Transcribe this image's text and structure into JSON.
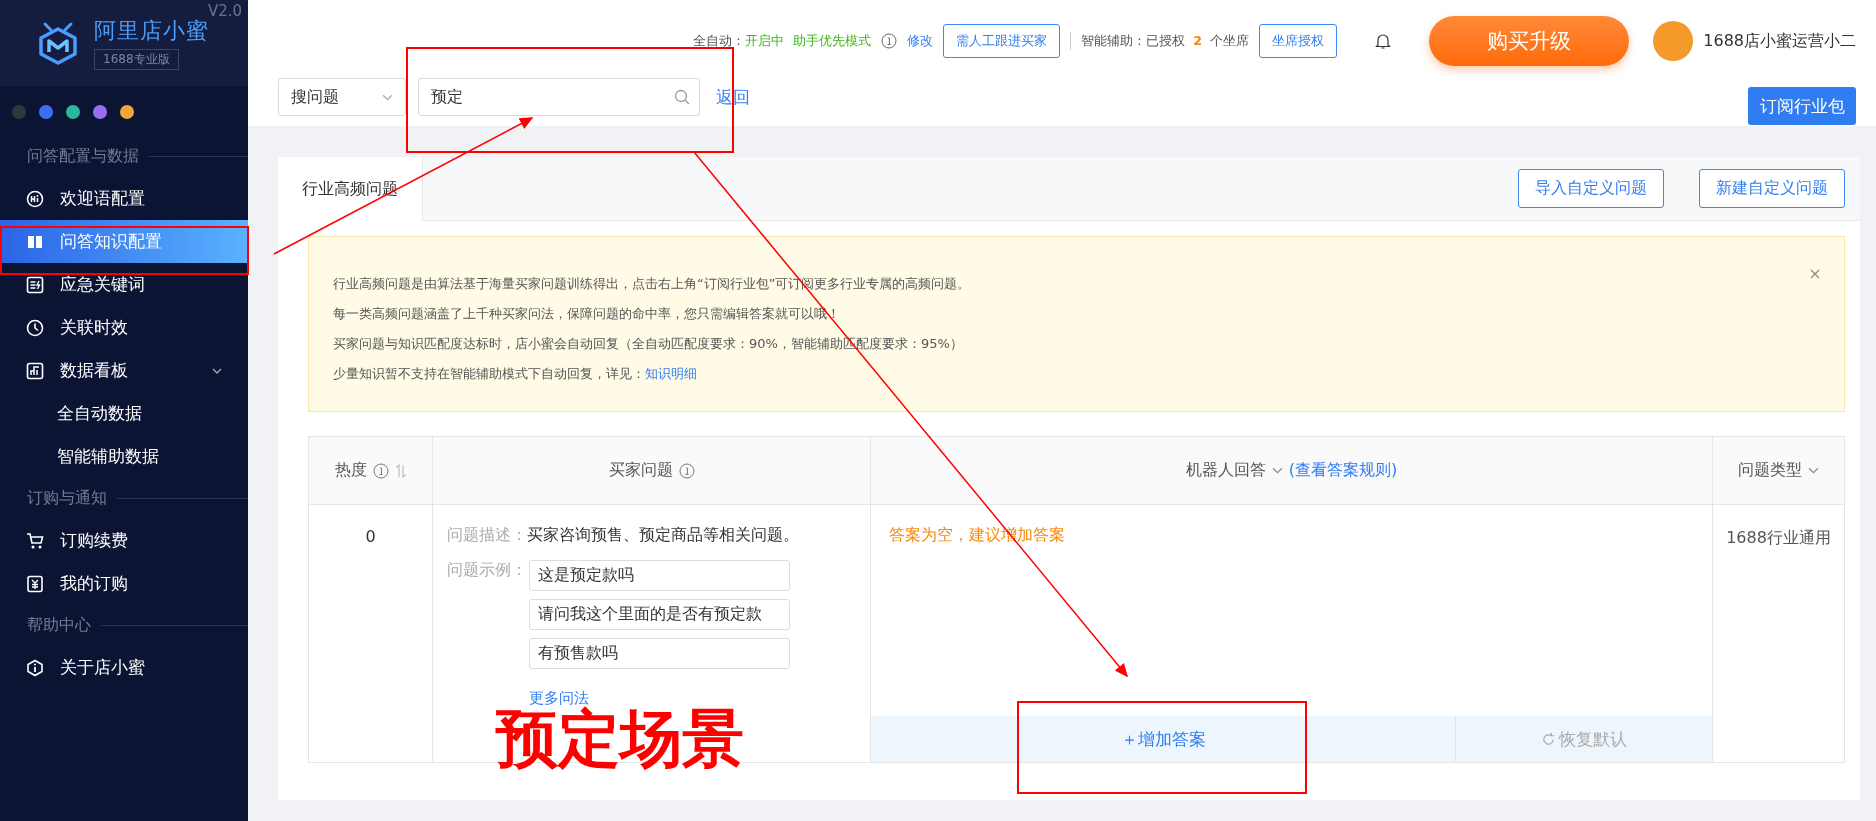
{
  "brand": {
    "name": "阿里店小蜜",
    "edition": "1688专业版",
    "version": "V2.0"
  },
  "theme_dots": [
    {
      "color": "#2b3a3a"
    },
    {
      "color": "#3d6ff5"
    },
    {
      "color": "#2bb89a"
    },
    {
      "color": "#9b6cf0"
    },
    {
      "color": "#f3a43a"
    }
  ],
  "sidebar": {
    "sections": [
      {
        "title": "问答配置与数据",
        "items": [
          {
            "kind": "hi",
            "label": "欢迎语配置",
            "selected": false
          },
          {
            "kind": "book",
            "label": "问答知识配置",
            "selected": true
          },
          {
            "kind": "keyword",
            "label": "应急关键词",
            "selected": false
          },
          {
            "kind": "clock",
            "label": "关联时效",
            "selected": false
          },
          {
            "kind": "chart",
            "label": "数据看板",
            "selected": false,
            "expanded": true,
            "children": [
              {
                "label": "全自动数据",
                "selected": false
              },
              {
                "label": "智能辅助数据",
                "selected": false
              }
            ]
          }
        ]
      },
      {
        "title": "订购与通知",
        "items": [
          {
            "kind": "cart",
            "label": "订购续费",
            "selected": false
          },
          {
            "kind": "order",
            "label": "我的订购",
            "selected": false
          }
        ]
      },
      {
        "title": "帮助中心",
        "items": [
          {
            "kind": "info",
            "label": "关于店小蜜",
            "selected": false
          }
        ]
      }
    ]
  },
  "header": {
    "auto_label": "全自动：",
    "auto_status": "开启中",
    "auto_mode": "助手优先模式",
    "edit_link": "修改",
    "manual_button": "需人工跟进买家",
    "assist_label": "智能辅助：已授权",
    "assist_count": "2",
    "assist_unit": "个坐席",
    "seat_button": "坐席授权",
    "upgrade_button": "购买升级",
    "user_name": "1688店小蜜运营小二"
  },
  "search": {
    "scope": "搜问题",
    "value": "预定",
    "back_link": "返回",
    "subscribe_button": "订阅行业包"
  },
  "tabs": [
    {
      "label": "行业高频问题",
      "selected": true
    }
  ],
  "actions": [
    "导入自定义问题",
    "新建自定义问题"
  ],
  "notice": {
    "lines": [
      "行业高频问题是由算法基于海量买家问题训练得出，点击右上角“订阅行业包”可订阅更多行业专属的高频问题。",
      "每一类高频问题涵盖了上千种买家问法，保障问题的命中率，您只需编辑答案就可以哦！",
      "买家问题与知识匹配度达标时，店小蜜会自动回复（全自动匹配度要求：90%，智能辅助匹配度要求：95%）"
    ],
    "last_line": "少量知识暂不支持在智能辅助模式下自动回复，详见：",
    "link": "知识明细"
  },
  "table": {
    "columns": [
      {
        "label": "热度",
        "info": true,
        "sort": true,
        "dropdown": false
      },
      {
        "label": "买家问题",
        "info": true,
        "sort": false,
        "dropdown": false
      },
      {
        "label": "机器人回答",
        "info": false,
        "sort": false,
        "dropdown": true,
        "link": "(查看答案规则)"
      },
      {
        "label": "问题类型",
        "info": false,
        "sort": false,
        "dropdown": true
      }
    ],
    "rows": [
      {
        "heat": "0",
        "desc_label": "问题描述：",
        "desc": "买家咨询预售、预定商品等相关问题。",
        "examples_label": "问题示例：",
        "examples": [
          "这是预定款吗",
          "请问我这个里面的是否有预定款",
          "有预售款吗"
        ],
        "more_link": "更多问法",
        "answer_empty": "答案为空，建议增加答案",
        "add_button": "＋增加答案",
        "reset_button": "恢复默认",
        "type": "1688行业通用"
      }
    ]
  },
  "annotation": {
    "caption": "预定场景"
  }
}
